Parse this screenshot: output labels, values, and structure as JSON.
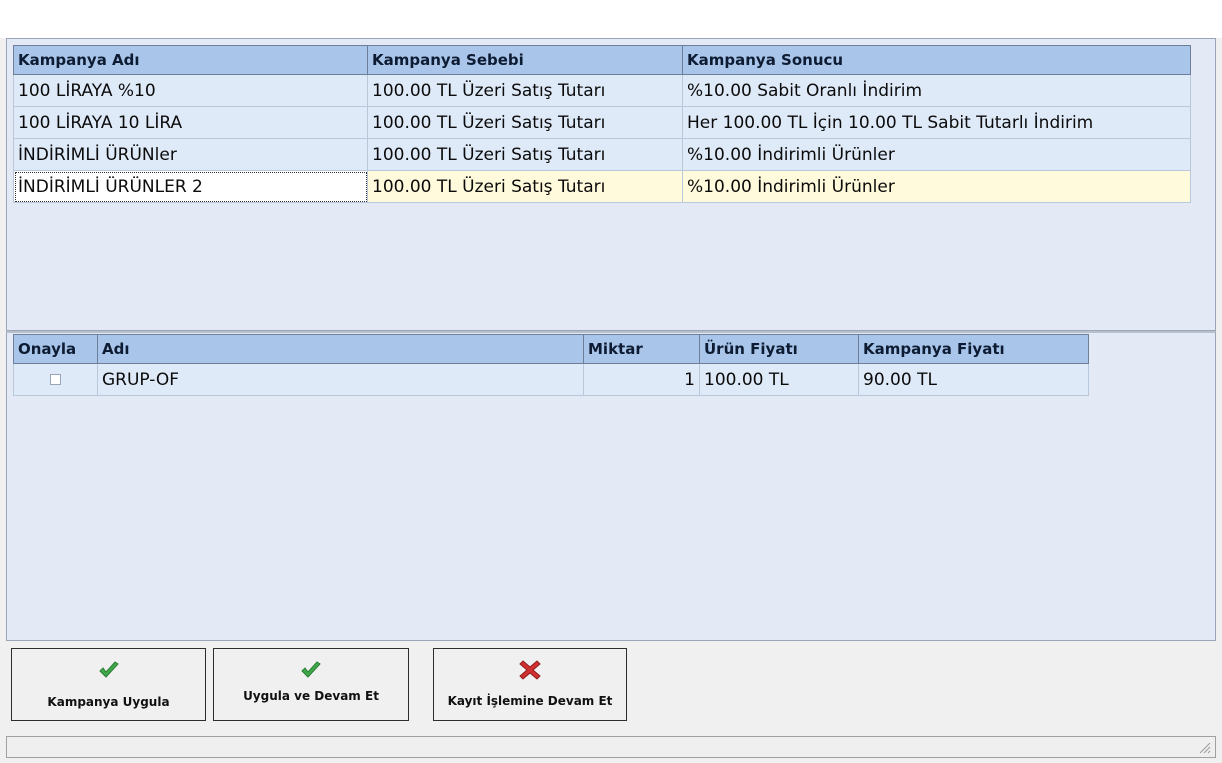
{
  "campaigns": {
    "columns": [
      "Kampanya Adı",
      "Kampanya Sebebi",
      "Kampanya Sonucu"
    ],
    "rows": [
      [
        "100 LİRAYA %10",
        "100.00 TL Üzeri Satış Tutarı",
        "%10.00 Sabit Oranlı İndirim"
      ],
      [
        "100 LİRAYA 10 LİRA",
        "100.00 TL Üzeri Satış Tutarı",
        "Her 100.00 TL İçin 10.00 TL Sabit Tutarlı İndirim"
      ],
      [
        "İNDİRİMLİ ÜRÜNler",
        "100.00 TL Üzeri Satış Tutarı",
        "%10.00 İndirimli Ürünler"
      ],
      [
        "İNDİRİMLİ ÜRÜNLER 2",
        "100.00 TL Üzeri Satış Tutarı",
        "%10.00 İndirimli Ürünler"
      ]
    ],
    "selected_row": 3
  },
  "products": {
    "columns": [
      "Onayla",
      "Adı",
      "Miktar",
      "Ürün Fiyatı",
      "Kampanya Fiyatı"
    ],
    "rows": [
      {
        "approved": false,
        "name": "GRUP-OF",
        "quantity": "1",
        "price": "100.00 TL",
        "campaign_price": "90.00 TL"
      }
    ]
  },
  "buttons": {
    "apply_label": "Kampanya Uygula",
    "apply_continue_label": "Uygula ve Devam Et",
    "continue_record_label": "Kayıt İşlemine Devam Et"
  },
  "icons": {
    "apply": "green-check-icon",
    "apply_continue": "green-check-icon",
    "continue_record": "red-x-icon"
  },
  "colors": {
    "header_bg": "#a9c6ea",
    "row_bg": "#dfeaf8",
    "selected_row_bg": "#fffadc",
    "check_green": "#3ea84a",
    "cancel_red": "#d0302f"
  }
}
